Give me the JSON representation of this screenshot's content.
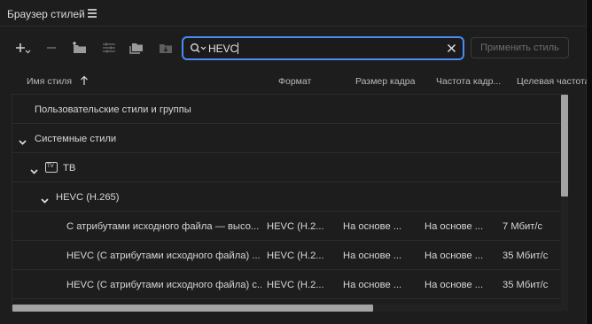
{
  "panel": {
    "title": "Браузер стилей",
    "menu_icon": "hamburger-icon"
  },
  "toolbar": {
    "icons": [
      "add-dropdown-icon",
      "remove-icon",
      "new-group-icon",
      "settings-icon",
      "duplicate-icon",
      "import-icon"
    ],
    "search_value": "HEVC",
    "search_icon": "search-dropdown-icon",
    "clear_icon": "close-icon",
    "apply_label": "Применить стиль"
  },
  "columns": {
    "name": "Имя стиля",
    "format": "Формат",
    "frame_size": "Размер кадра",
    "frame_rate": "Частота кадр...",
    "target": "Целевая частота"
  },
  "tree": {
    "user_presets": "Пользовательские стили и группы",
    "system_presets": "Системные стили",
    "tv_group": "ТВ",
    "tv_icon_text": "TV",
    "hevc_group": "HEVC (H.265)",
    "rows": [
      {
        "name": "С атрибутами исходного файла — высо...",
        "format": "HEVC (H.2...",
        "frame_size": "На основе ...",
        "frame_rate": "На основе ...",
        "target": "7 Мбит/с"
      },
      {
        "name": "HEVC (С атрибутами исходного файла) ...",
        "format": "HEVC (H.2...",
        "frame_size": "На основе ...",
        "frame_rate": "На основе ...",
        "target": "35 Мбит/с"
      },
      {
        "name": "HEVC (С атрибутами исходного файла) с...",
        "format": "HEVC (H.2...",
        "frame_size": "На основе ...",
        "frame_rate": "На основе ...",
        "target": "35 Мбит/с"
      }
    ]
  },
  "colors": {
    "accent": "#4a8cf4",
    "panel_bg": "#1d1d1d",
    "text": "#d6d6d6"
  }
}
